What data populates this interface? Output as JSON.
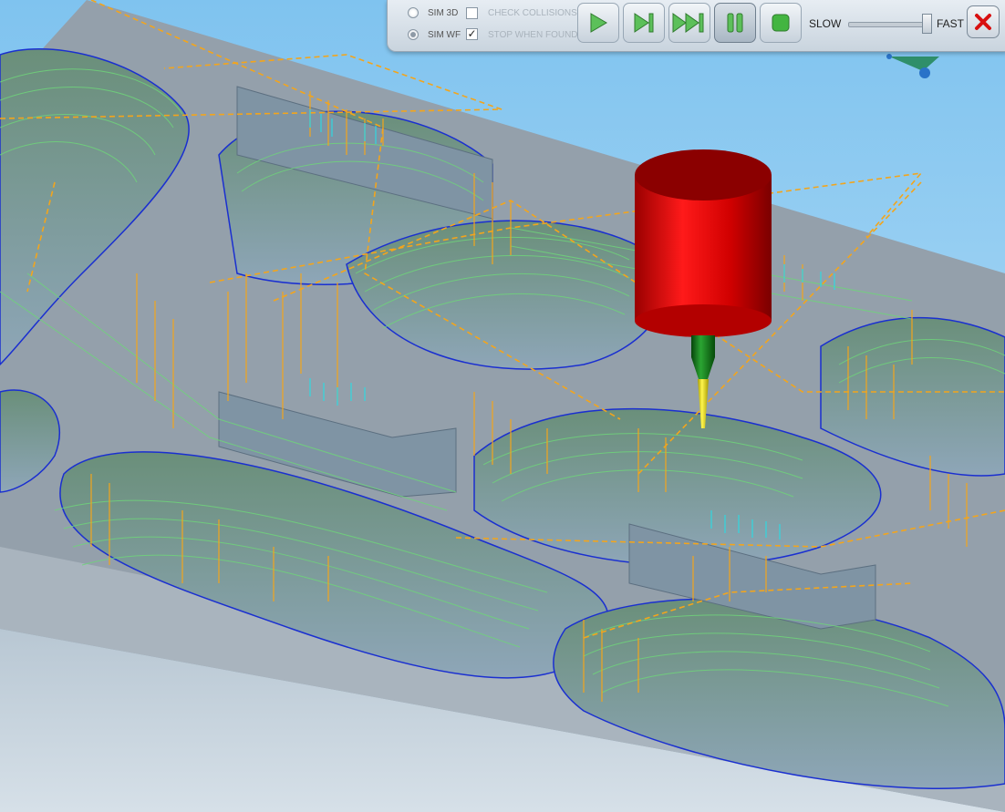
{
  "toolbar": {
    "sim_3d_label": "SIM 3D",
    "sim_wf_label": "SIM WF",
    "check_collisions_label": "CHECK COLLISIONS",
    "stop_when_found_label": "STOP WHEN FOUND",
    "sim_3d_selected": false,
    "sim_wf_selected": true,
    "check_collisions_checked": false,
    "stop_when_found_checked": true,
    "buttons": [
      {
        "name": "play",
        "icon": "play-icon"
      },
      {
        "name": "step",
        "icon": "step-forward-icon"
      },
      {
        "name": "fast-forward",
        "icon": "fast-forward-icon"
      },
      {
        "name": "pause",
        "icon": "pause-icon"
      },
      {
        "name": "stop",
        "icon": "stop-icon"
      }
    ],
    "speed_slow_label": "SLOW",
    "speed_fast_label": "FAST",
    "speed_value": 0.95,
    "close_icon": "close-icon"
  },
  "scene": {
    "tool_holder_color": "#e00000",
    "tool_shank_color": "#0f7a16",
    "tool_tip_color": "#f3ea1a",
    "toolpath_color": "#6fd47a",
    "rapid_move_color": "#f3a51c",
    "boundary_color": "#1a2fd0",
    "stock_color": "#8f9aa6",
    "sky_color": "#9fd0f0"
  }
}
